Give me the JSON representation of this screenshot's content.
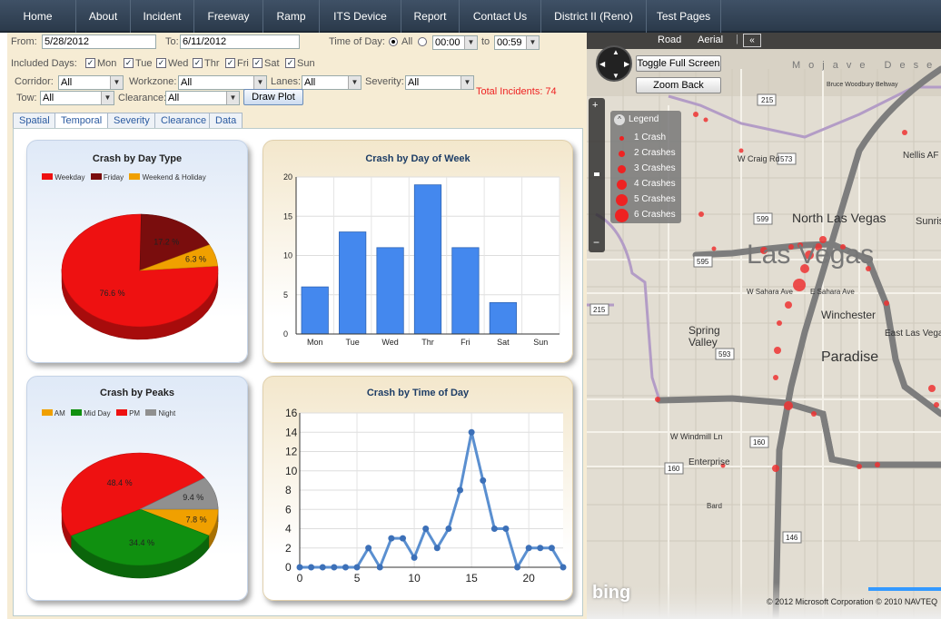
{
  "nav": {
    "items": [
      "Home",
      "About",
      "Incident",
      "Freeway",
      "Ramp",
      "ITS Device",
      "Report",
      "Contact Us",
      "District II (Reno)",
      "Test Pages"
    ]
  },
  "filters": {
    "from_label": "From:",
    "from_value": "5/28/2012",
    "to_label": "To:",
    "to_value": "6/11/2012",
    "time_label": "Time of Day:",
    "time_all_label": "All",
    "time_start": "00:00",
    "time_to_label": "to",
    "time_end": "00:59",
    "included_days_label": "Included Days:",
    "days": [
      "Mon",
      "Tue",
      "Wed",
      "Thr",
      "Fri",
      "Sat",
      "Sun"
    ],
    "corridor_label": "Corridor:",
    "corridor_value": "All",
    "workzone_label": "Workzone:",
    "workzone_value": "All",
    "lanes_label": "Lanes:",
    "lanes_value": "All",
    "severity_label": "Severity:",
    "severity_value": "All",
    "tow_label": "Tow:",
    "tow_value": "All",
    "clearance_label": "Clearance:",
    "clearance_value": "All",
    "draw_plot_label": "Draw Plot",
    "total_incidents": "Total Incidents: 74"
  },
  "tabs": [
    "Spatial",
    "Temporal",
    "Severity",
    "Clearance",
    "Data"
  ],
  "active_tab": "Temporal",
  "colors": {
    "weekday": "#ee1111",
    "friday": "#7a0d0d",
    "weekend": "#f0a000",
    "am": "#f0a000",
    "midday": "#109010",
    "pm": "#ee1111",
    "night": "#909090",
    "bar": "#4488ee",
    "line": "#5a8fd0"
  },
  "chart_data": [
    {
      "type": "pie",
      "title": "Crash by Day Type",
      "labels": [
        "Weekday",
        "Friday",
        "Weekend & Holiday"
      ],
      "values": [
        76.6,
        17.2,
        6.3
      ],
      "value_labels": [
        "76.6 %",
        "17.2 %",
        "6.3 %"
      ],
      "legend": "top"
    },
    {
      "type": "bar",
      "title": "Crash by Day of Week",
      "categories": [
        "Mon",
        "Tue",
        "Wed",
        "Thr",
        "Fri",
        "Sat",
        "Sun"
      ],
      "values": [
        6,
        13,
        11,
        19,
        11,
        4,
        0
      ],
      "ylim": [
        0,
        20
      ],
      "yticks": [
        0,
        5,
        10,
        15,
        20
      ],
      "grid": true
    },
    {
      "type": "pie",
      "title": "Crash by Peaks",
      "labels": [
        "AM",
        "Mid Day",
        "PM",
        "Night"
      ],
      "values": [
        7.8,
        34.4,
        48.4,
        9.4
      ],
      "value_labels": [
        "7.8 %",
        "34.4 %",
        "48.4 %",
        "9.4 %"
      ],
      "legend": "top"
    },
    {
      "type": "line",
      "title": "Crash by Time of Day",
      "x": [
        0,
        1,
        2,
        3,
        4,
        5,
        6,
        7,
        8,
        9,
        10,
        11,
        12,
        13,
        14,
        15,
        16,
        17,
        18,
        19,
        20,
        21,
        22,
        23
      ],
      "y": [
        0,
        0,
        0,
        0,
        0,
        0,
        2,
        0,
        3,
        3,
        1,
        4,
        2,
        4,
        8,
        14,
        9,
        4,
        4,
        0,
        2,
        2,
        2,
        0
      ],
      "xlim": [
        0,
        23
      ],
      "ylim": [
        0,
        16
      ],
      "xticks": [
        0,
        5,
        10,
        15,
        20
      ],
      "yticks": [
        0,
        2,
        4,
        6,
        8,
        10,
        12,
        14,
        16
      ],
      "ytick_labels": [
        "0",
        "2",
        "4",
        "6",
        "8",
        "10",
        "12",
        "14",
        "16"
      ],
      "grid": true
    }
  ],
  "map": {
    "road_label": "Road",
    "aerial_label": "Aerial",
    "toggle_fullscreen_label": "Toggle Full Screen",
    "zoom_back_label": "Zoom Back",
    "legend_title": "Legend",
    "legend_items": [
      "1 Crash",
      "2 Crashes",
      "3 Crashes",
      "4 Crashes",
      "5 Crashes",
      "6 Crashes"
    ],
    "places": [
      "North Las Vegas",
      "Las Vegas",
      "Spring Valley",
      "Winchester",
      "Paradise",
      "East Las Vegas",
      "Enterprise",
      "Sunrise",
      "Nellis AF",
      "Mojave Desert",
      "W Craig Rd",
      "W Sahara Ave",
      "E Sahara Ave",
      "W Windmill Ln",
      "Bruce Woodbury Beltway",
      "Bard"
    ],
    "route_shields": [
      "215",
      "573",
      "599",
      "595",
      "593",
      "215",
      "160",
      "160",
      "146"
    ],
    "copyright": "© 2012 Microsoft Corporation  © 2010 NAVTEQ",
    "bing_label": "bing"
  }
}
